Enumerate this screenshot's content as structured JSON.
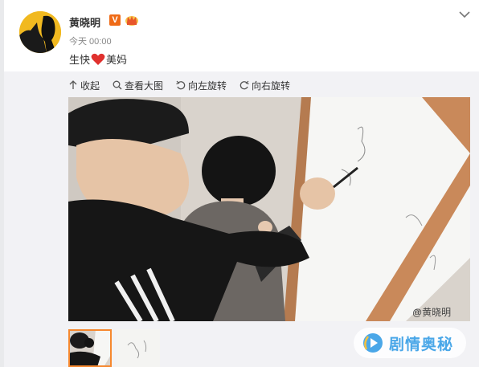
{
  "post": {
    "username": "黄晓明",
    "verified_badge": "V",
    "timestamp": "今天 00:00",
    "text_before": "生快",
    "text_after": "美妈",
    "heart_icon": "red-heart-emoji"
  },
  "toolbar": {
    "collapse_label": "收起",
    "view_large_label": "查看大图",
    "rotate_left_label": "向左旋转",
    "rotate_right_label": "向右旋转"
  },
  "photo": {
    "watermark": "@黄晓明",
    "thumbnail_count": 2,
    "active_thumbnail": 1
  },
  "site_watermark": {
    "text": "剧情奥秘"
  },
  "colors": {
    "accent_orange": "#f6882f",
    "verified_orange": "#ef6b17",
    "heart_red": "#e0312e",
    "watermark_blue": "#4aa7e8"
  }
}
